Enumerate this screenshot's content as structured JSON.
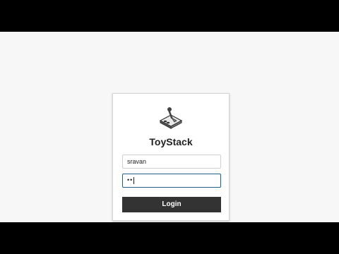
{
  "app": {
    "title": "ToyStack",
    "logo_icon": "joystick-icon"
  },
  "form": {
    "username_value": "sravan",
    "password_masked": "••",
    "login_label": "Login"
  },
  "colors": {
    "page_background": "#f7f7f7",
    "letterbox": "#000000",
    "button_background": "#333333",
    "focused_border": "#1f5f8b"
  }
}
